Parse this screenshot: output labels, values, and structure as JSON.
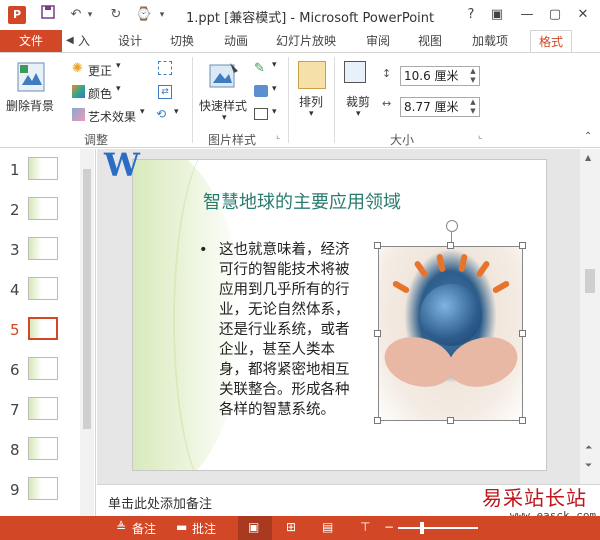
{
  "titlebar": {
    "app_icon": "P",
    "title": "1.ppt [兼容模式] - Microsoft PowerPoint",
    "help": "?",
    "minimize": "—",
    "close": "✕"
  },
  "tabs": {
    "file": "文件",
    "items": [
      "入",
      "设计",
      "切换",
      "动画",
      "幻灯片放映",
      "审阅",
      "视图",
      "加载项",
      "格式"
    ]
  },
  "ribbon": {
    "remove_bg": "删除背景",
    "corrections": "更正",
    "color": "颜色",
    "artistic": "艺术效果",
    "group_adjust": "调整",
    "quick_styles": "快速样式",
    "group_styles": "图片样式",
    "arrange": "排列",
    "crop": "裁剪",
    "height": "10.6 厘米",
    "width": "8.77 厘米",
    "group_size": "大小"
  },
  "thumbnails": {
    "numbers": [
      "1",
      "2",
      "3",
      "4",
      "5",
      "6",
      "7",
      "8",
      "9"
    ],
    "active_index": 5
  },
  "slide": {
    "title": "智慧地球的主要应用领域",
    "bullet_dot": "•",
    "bullet_text": "这也就意味着，经济可行的智能技术将被应用到几乎所有的行业，无论自然体系，还是行业系统，或者企业，甚至人类本身，都将紧密地相互关联整合。形成各种各样的智慧系统。"
  },
  "notes": {
    "placeholder": "单击此处添加备注"
  },
  "status": {
    "notes": "备注",
    "comments": "批注"
  },
  "watermark": {
    "text": "易采站长站",
    "url": "www.easck.com"
  },
  "colors": {
    "accent": "#d24726",
    "title_teal": "#2a7b6f"
  }
}
